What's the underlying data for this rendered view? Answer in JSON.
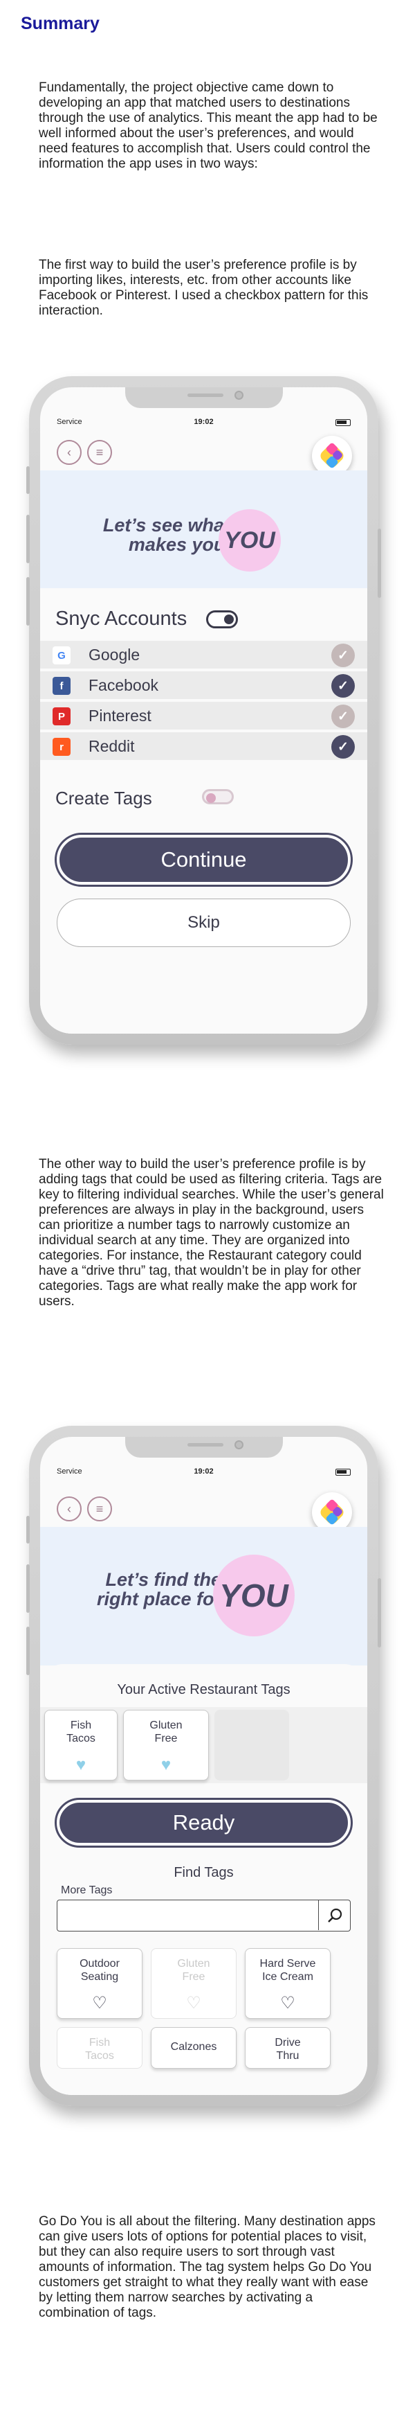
{
  "heading": "Summary",
  "paragraphs": {
    "p1": "Fundamentally, the project objective came down to developing an app that matched users to destinations through the use of analytics. This meant the app had to be well informed about the user’s preferences, and would need features to accomplish that. Users could control the information the app uses in two ways:",
    "p2": "The first way to build the user’s preference profile is by importing likes, interests, etc. from other accounts like Facebook or Pinterest. I used a checkbox pattern for this interaction.",
    "p3": "The other way to build the user’s preference profile is by adding tags that could be used as filtering criteria. Tags are key to filtering individual searches. While the user’s general preferences are always in play in the background, users can prioritize a number tags to narrowly customize an individual search at any time. They are organized into categories. For instance, the Restaurant category could have a “drive thru” tag, that wouldn’t be in play for other categories. Tags are what really make the app work for users.",
    "p4": "Go Do You is all about the filtering. Many destination apps can give users lots of options for potential places to visit, but they can also require users to sort through vast amounts of information. The tag system helps Go Do You customers get straight to what they really want with ease by letting them narrow searches by activating a combination of tags."
  },
  "phone1": {
    "status": {
      "carrier": "Service",
      "time": "19:02"
    },
    "hero_line1": "Let’s see what",
    "hero_line2": "makes you,",
    "hero_you": "YOU",
    "sync_title": "Snyc Accounts",
    "accounts": [
      {
        "name": "Google",
        "logo": "G",
        "logo_color": "#ffffff",
        "checked": false
      },
      {
        "name": "Facebook",
        "logo": "f",
        "logo_color": "#3b5998",
        "checked": true
      },
      {
        "name": "Pinterest",
        "logo": "P",
        "logo_color": "#e02a2a",
        "checked": false
      },
      {
        "name": "Reddit",
        "logo": "r",
        "logo_color": "#ff5a1f",
        "checked": true
      }
    ],
    "create_tags": "Create Tags",
    "continue": "Continue",
    "skip": "Skip"
  },
  "phone2": {
    "status": {
      "carrier": "Service",
      "time": "19:02"
    },
    "hero_line1": "Let’s find the",
    "hero_line2": "right place for",
    "hero_you": "YOU",
    "active_title": "Your Active Restaurant Tags",
    "active_tags": [
      {
        "l1": "Fish",
        "l2": "Tacos"
      },
      {
        "l1": "Gluten",
        "l2": "Free"
      }
    ],
    "ready": "Ready",
    "find_title": "Find Tags",
    "more_tags": "More Tags",
    "search_value": "",
    "tags_row1": [
      {
        "l1": "Outdoor",
        "l2": "Seating",
        "dim": false
      },
      {
        "l1": "Gluten",
        "l2": "Free",
        "dim": true
      },
      {
        "l1": "Hard Serve",
        "l2": "Ice Cream",
        "dim": false
      }
    ],
    "tags_row2": [
      {
        "l1": "Fish",
        "l2": "Tacos",
        "dim": true
      },
      {
        "l1": "Calzones",
        "l2": "",
        "dim": false
      },
      {
        "l1": "Drive",
        "l2": "Thru",
        "dim": false
      }
    ]
  },
  "colors": {
    "heading": "#1a1a9a",
    "primary": "#4a4a66",
    "accent_pink": "#f7c9ec",
    "accent_blue": "#8fd0e8"
  }
}
